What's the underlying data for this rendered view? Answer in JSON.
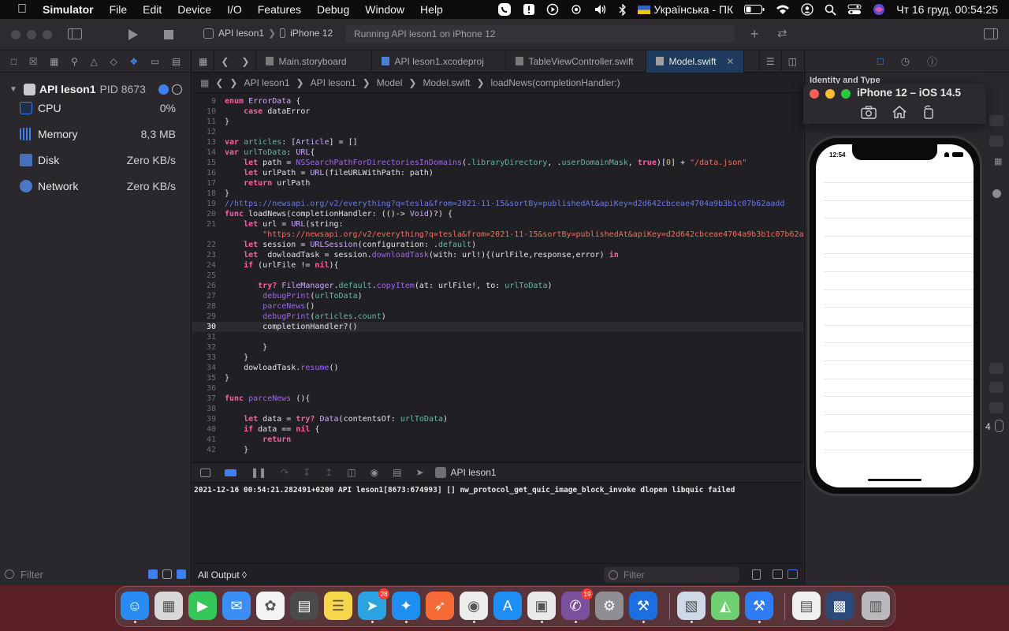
{
  "menubar": {
    "app_name": "Simulator",
    "items": [
      "File",
      "Edit",
      "Device",
      "I/O",
      "Features",
      "Debug",
      "Window",
      "Help"
    ],
    "keyboard_layout": "Українська - ПК",
    "datetime": "Чт 16 груд.  00:54:25",
    "status_icons": [
      "viber-icon",
      "warning-icon",
      "play-icon",
      "airdrop-icon",
      "volume-icon",
      "bluetooth-icon",
      "battery-icon",
      "wifi-icon",
      "user-icon",
      "search-icon",
      "control-center-icon",
      "siri-icon"
    ]
  },
  "toolbar": {
    "scheme": "API leson1",
    "destination": "iPhone 12",
    "activity": "Running API leson1 on iPhone 12"
  },
  "debug_navigator": {
    "process_name": "API leson1",
    "process_pid": "PID 8673",
    "gauges": [
      {
        "label": "CPU",
        "value": "0%"
      },
      {
        "label": "Memory",
        "value": "8,3 MB"
      },
      {
        "label": "Disk",
        "value": "Zero KB/s"
      },
      {
        "label": "Network",
        "value": "Zero KB/s"
      }
    ],
    "filter_placeholder": "Filter"
  },
  "tabs": [
    {
      "label": "Main.storyboard",
      "active": false
    },
    {
      "label": "API leson1.xcodeproj",
      "active": false
    },
    {
      "label": "TableViewController.swift",
      "active": false
    },
    {
      "label": "Model.swift",
      "active": true
    }
  ],
  "jumpbar": [
    "API leson1",
    "API leson1",
    "Model",
    "Model.swift",
    "loadNews(completionHandler:)"
  ],
  "code": {
    "current_line": "30",
    "lines": [
      {
        "n": "9",
        "t": "enum ErrorData {"
      },
      {
        "n": "10",
        "t": "    case dataError"
      },
      {
        "n": "11",
        "t": "}"
      },
      {
        "n": "12",
        "t": ""
      },
      {
        "n": "13",
        "t": "var articles: [Article] = []"
      },
      {
        "n": "14",
        "t": "var urlToData: URL{"
      },
      {
        "n": "15",
        "t": "    let path = NSSearchPathForDirectoriesInDomains(.libraryDirectory, .userDomainMask, true)[0] + \"/data.json\""
      },
      {
        "n": "16",
        "t": "    let urlPath = URL(fileURLWithPath: path)"
      },
      {
        "n": "17",
        "t": "    return urlPath"
      },
      {
        "n": "18",
        "t": "}"
      },
      {
        "n": "19",
        "t": "//https://newsapi.org/v2/everything?q=tesla&from=2021-11-15&sortBy=publishedAt&apiKey=d2d642cbceae4704a9b3b1c07b62aadd"
      },
      {
        "n": "20",
        "t": "func loadNews(completionHandler: (()-> Void)?) {"
      },
      {
        "n": "21",
        "t": "    let url = URL(string:"
      },
      {
        "n": "",
        "t": "        \"https://newsapi.org/v2/everything?q=tesla&from=2021-11-15&sortBy=publishedAt&apiKey=d2d642cbceae4704a9b3b1c07b62aadd\")"
      },
      {
        "n": "22",
        "t": "    let session = URLSession(configuration: .default)"
      },
      {
        "n": "23",
        "t": "    let  dowloadTask = session.downloadTask(with: url!){(urlFile,response,error) in"
      },
      {
        "n": "24",
        "t": "    if (urlFile != nil){"
      },
      {
        "n": "25",
        "t": ""
      },
      {
        "n": "26",
        "t": "       try? FileManager.default.copyItem(at: urlFile!, to: urlToData)"
      },
      {
        "n": "27",
        "t": "        debugPrint(urlToData)"
      },
      {
        "n": "28",
        "t": "        parceNews()"
      },
      {
        "n": "29",
        "t": "        debugPrint(articles.count)"
      },
      {
        "n": "30",
        "t": "        completionHandler?()"
      },
      {
        "n": "31",
        "t": ""
      },
      {
        "n": "32",
        "t": "        }"
      },
      {
        "n": "33",
        "t": "    }"
      },
      {
        "n": "34",
        "t": "    dowloadTask.resume()"
      },
      {
        "n": "35",
        "t": "}"
      },
      {
        "n": "36",
        "t": ""
      },
      {
        "n": "37",
        "t": "func parceNews (){"
      },
      {
        "n": "38",
        "t": ""
      },
      {
        "n": "39",
        "t": "    let data = try? Data(contentsOf: urlToData)"
      },
      {
        "n": "40",
        "t": "    if data == nil {"
      },
      {
        "n": "41",
        "t": "        return"
      },
      {
        "n": "42",
        "t": "    }"
      }
    ]
  },
  "debug_bar": {
    "target": "API leson1"
  },
  "console": {
    "lines": [
      "2021-12-16 00:54:21.282491+0200 API leson1[8673:674993] [] nw_protocol_get_quic_image_block_invoke dlopen libquic failed"
    ],
    "output_selector": "All Output ◊",
    "filter_placeholder": "Filter"
  },
  "inspector": {
    "title": "Identity and Type",
    "stepper_value": "4"
  },
  "simulator": {
    "title": "iPhone 12 – iOS 14.5",
    "time": "12:54"
  },
  "dock": {
    "apps": [
      {
        "name": "finder-icon",
        "color": "#2a8bf2",
        "running": true,
        "badge": ""
      },
      {
        "name": "launchpad-icon",
        "color": "#d8d8d8",
        "running": false,
        "badge": ""
      },
      {
        "name": "facetime-icon",
        "color": "#34c759",
        "running": false,
        "badge": ""
      },
      {
        "name": "mail-icon",
        "color": "#3a8ef6",
        "running": false,
        "badge": ""
      },
      {
        "name": "photos-icon",
        "color": "#f5f5f5",
        "running": false,
        "badge": ""
      },
      {
        "name": "calculator-icon",
        "color": "#4a4a4a",
        "running": false,
        "badge": ""
      },
      {
        "name": "notes-icon",
        "color": "#f7d64a",
        "running": false,
        "badge": ""
      },
      {
        "name": "telegram-icon",
        "color": "#2aa3e0",
        "running": true,
        "badge": "28"
      },
      {
        "name": "safari-icon",
        "color": "#1f8ef1",
        "running": true,
        "badge": ""
      },
      {
        "name": "swift-playgrounds-icon",
        "color": "#f56a35",
        "running": false,
        "badge": ""
      },
      {
        "name": "chrome-icon",
        "color": "#ececec",
        "running": true,
        "badge": ""
      },
      {
        "name": "app-store-icon",
        "color": "#1d8ef5",
        "running": false,
        "badge": ""
      },
      {
        "name": "simulator-icon",
        "color": "#e9e9e9",
        "running": true,
        "badge": ""
      },
      {
        "name": "viber-icon",
        "color": "#7b519d",
        "running": true,
        "badge": "19"
      },
      {
        "name": "system-preferences-icon",
        "color": "#8e8e93",
        "running": false,
        "badge": ""
      },
      {
        "name": "xcode-icon",
        "color": "#1c6fe0",
        "running": true,
        "badge": ""
      },
      {
        "name": "preview-icon",
        "color": "#cfd8e6",
        "running": true,
        "badge": ""
      },
      {
        "name": "maps-icon",
        "color": "#6fcf73",
        "running": false,
        "badge": ""
      },
      {
        "name": "xcode-build-icon",
        "color": "#2e7cf6",
        "running": true,
        "badge": ""
      },
      {
        "name": "document-thumbnail-icon",
        "color": "#f0f0f0",
        "running": false,
        "badge": ""
      },
      {
        "name": "desktop-thumbnail-icon",
        "color": "#2b4a7a",
        "running": false,
        "badge": ""
      },
      {
        "name": "trash-icon",
        "color": "#b9b9be",
        "running": false,
        "badge": ""
      }
    ]
  }
}
